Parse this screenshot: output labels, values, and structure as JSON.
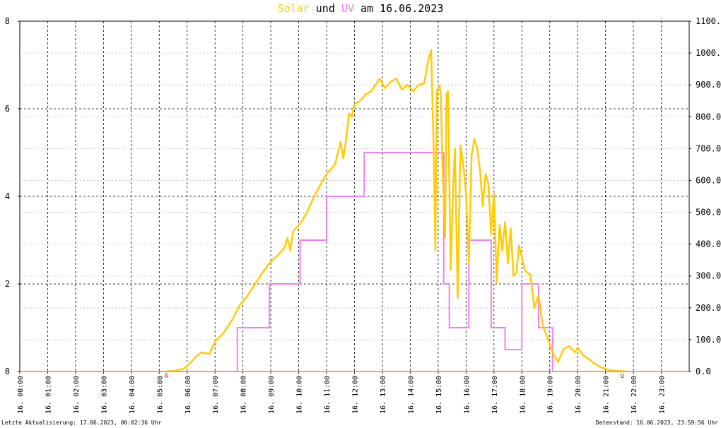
{
  "title": {
    "solar_word": "Solar",
    "und_word": "und",
    "uv_word": "UV",
    "date_text": "am 16.06.2023",
    "solar_color": "#FFCC00",
    "uv_color": "#EE82EE"
  },
  "footer": {
    "left": "Letzte Aktualisierung: 17.06.2023, 00:02:36 Uhr",
    "right": "Datenstand: 16.06.2023, 23:59:56 Uhr"
  },
  "chart_data": {
    "type": "line",
    "x_unit": "hours of day",
    "xlim": [
      0,
      24
    ],
    "x_tick_labels": [
      "16. 00:00",
      "16. 01:00",
      "16. 02:00",
      "16. 03:00",
      "16. 04:00",
      "16. 05:00",
      "16. 06:00",
      "16. 07:00",
      "16. 08:00",
      "16. 09:00",
      "16. 10:00",
      "16. 11:00",
      "16. 12:00",
      "16. 13:00",
      "16. 14:00",
      "16. 15:00",
      "16. 16:00",
      "16. 17:00",
      "16. 18:00",
      "16. 19:00",
      "16. 20:00",
      "16. 21:00",
      "16. 22:00",
      "16. 23:00"
    ],
    "left_axis": {
      "range": [
        0,
        8
      ],
      "tick_labels": [
        "0",
        "2",
        "4",
        "6",
        "8"
      ]
    },
    "right_axis": {
      "range": [
        0,
        1100
      ],
      "tick_labels": [
        "0.0",
        "100.0",
        "200.0",
        "300.0",
        "400.0",
        "500.0",
        "600.0",
        "700.0",
        "800.0",
        "900.0",
        "1000.0",
        "1100.0"
      ]
    },
    "grid": true,
    "markers": [
      {
        "label": "A",
        "x": 5.25,
        "color": "#CC0000"
      },
      {
        "label": "U",
        "x": 21.6,
        "color": "#CC0000"
      }
    ],
    "series": [
      {
        "name": "Solar",
        "color": "#FFCC00",
        "axis": "right",
        "x": [
          5.2,
          5.6,
          5.9,
          6.1,
          6.3,
          6.5,
          6.8,
          7.0,
          7.3,
          7.6,
          7.9,
          8.1,
          8.4,
          8.7,
          9.0,
          9.2,
          9.5,
          9.6,
          9.7,
          9.8,
          9.95,
          10.1,
          10.3,
          10.5,
          10.8,
          11.0,
          11.3,
          11.5,
          11.6,
          11.7,
          11.8,
          11.9,
          12.0,
          12.2,
          12.4,
          12.6,
          12.9,
          13.1,
          13.3,
          13.5,
          13.7,
          13.9,
          14.1,
          14.3,
          14.5,
          14.65,
          14.75,
          14.85,
          14.9,
          14.95,
          15.05,
          15.1,
          15.15,
          15.25,
          15.3,
          15.35,
          15.45,
          15.55,
          15.6,
          15.7,
          15.8,
          15.9,
          16.0,
          16.1,
          16.2,
          16.3,
          16.4,
          16.5,
          16.6,
          16.7,
          16.8,
          16.9,
          17.0,
          17.1,
          17.2,
          17.3,
          17.4,
          17.5,
          17.6,
          17.7,
          17.8,
          17.9,
          18.0,
          18.1,
          18.2,
          18.3,
          18.45,
          18.6,
          18.75,
          18.9,
          19.1,
          19.3,
          19.5,
          19.7,
          19.9,
          20.0,
          20.2,
          20.4,
          20.6,
          20.8,
          21.0,
          21.2,
          21.4,
          21.6,
          21.8
        ],
        "y": [
          0,
          2,
          10,
          25,
          45,
          60,
          55,
          95,
          120,
          160,
          210,
          230,
          270,
          310,
          345,
          360,
          390,
          420,
          380,
          440,
          455,
          470,
          500,
          540,
          590,
          620,
          650,
          720,
          670,
          730,
          810,
          800,
          840,
          850,
          870,
          880,
          920,
          890,
          910,
          920,
          885,
          900,
          880,
          900,
          905,
          980,
          1010,
          650,
          380,
          880,
          900,
          860,
          650,
          420,
          870,
          880,
          320,
          610,
          700,
          230,
          710,
          650,
          560,
          340,
          680,
          730,
          700,
          630,
          520,
          620,
          590,
          430,
          560,
          280,
          460,
          380,
          470,
          340,
          450,
          300,
          310,
          395,
          360,
          320,
          310,
          305,
          200,
          240,
          145,
          110,
          60,
          30,
          70,
          80,
          60,
          75,
          50,
          40,
          25,
          15,
          8,
          4,
          2,
          1,
          0
        ]
      },
      {
        "name": "UV",
        "color": "#EE82EE",
        "axis": "left",
        "step": true,
        "x": [
          0,
          7.8,
          8.95,
          10.05,
          11.0,
          11.95,
          12.35,
          12.95,
          13.5,
          14.8,
          15.2,
          15.4,
          15.8,
          16.1,
          16.9,
          17.4,
          18.0,
          18.6,
          19.1,
          24
        ],
        "y": [
          0,
          1,
          2,
          3,
          4,
          4,
          5,
          5,
          5,
          5,
          2,
          1,
          1,
          3,
          1,
          0.5,
          2,
          1,
          0,
          0
        ]
      }
    ]
  }
}
